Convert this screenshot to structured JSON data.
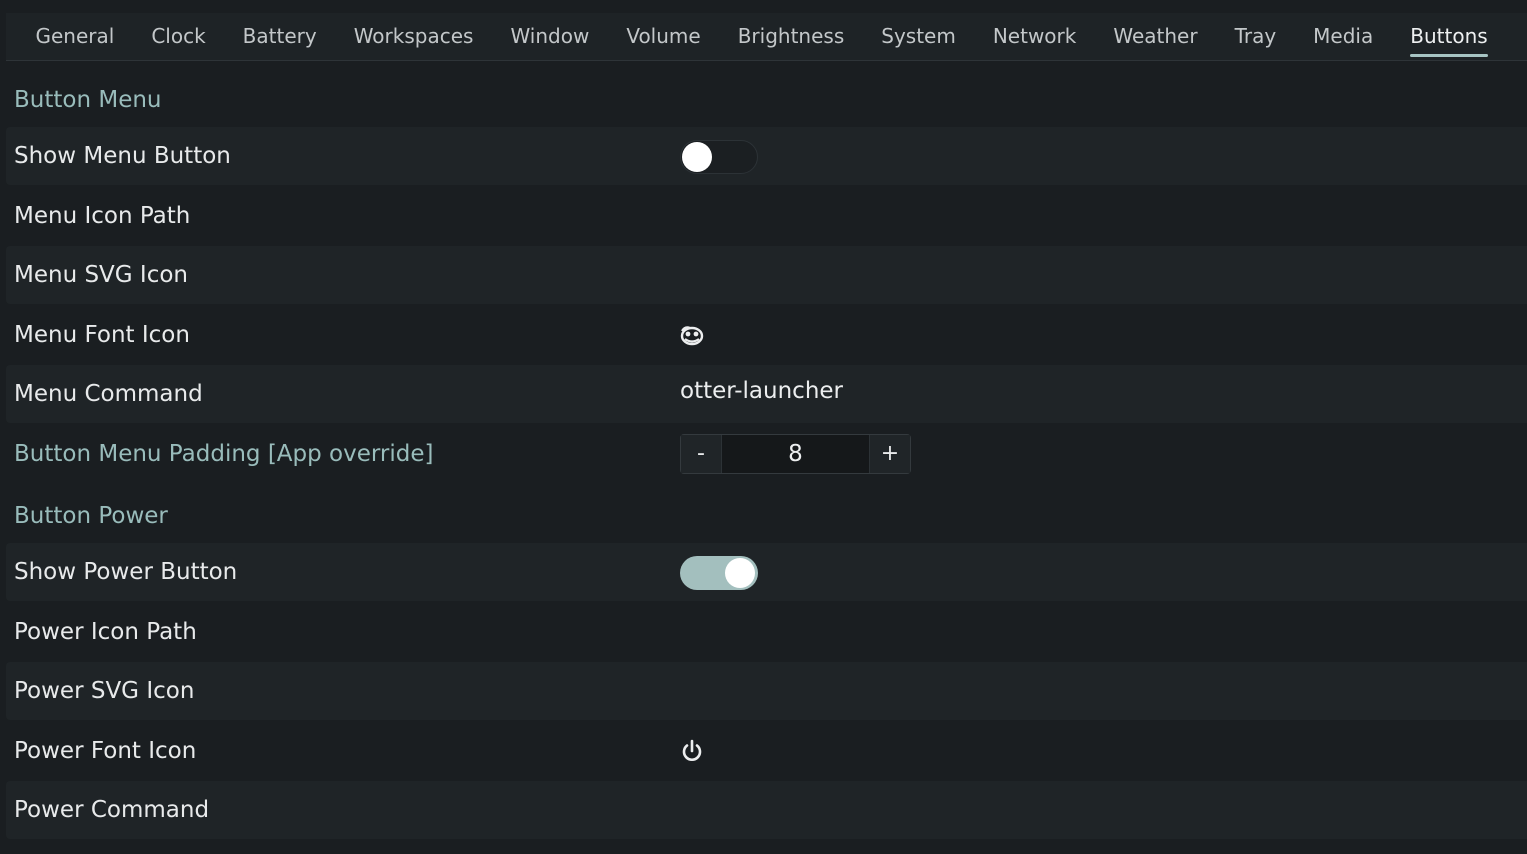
{
  "tabs": [
    {
      "label": "General"
    },
    {
      "label": "Clock"
    },
    {
      "label": "Battery"
    },
    {
      "label": "Workspaces"
    },
    {
      "label": "Window"
    },
    {
      "label": "Volume"
    },
    {
      "label": "Brightness"
    },
    {
      "label": "System"
    },
    {
      "label": "Network"
    },
    {
      "label": "Weather"
    },
    {
      "label": "Tray"
    },
    {
      "label": "Media"
    },
    {
      "label": "Buttons"
    }
  ],
  "active_tab": "Buttons",
  "button_menu": {
    "header": "Button Menu",
    "show_label": "Show Menu Button",
    "show_value": false,
    "icon_path_label": "Menu Icon Path",
    "icon_path_value": "",
    "svg_icon_label": "Menu SVG Icon",
    "svg_icon_value": "",
    "font_icon_label": "Menu Font Icon",
    "font_icon_name": "otter-icon",
    "command_label": "Menu Command",
    "command_value": "otter-launcher",
    "padding_label": "Button Menu Padding [App override]",
    "padding_minus": "-",
    "padding_value": "8",
    "padding_plus": "+"
  },
  "button_power": {
    "header": "Button Power",
    "show_label": "Show Power Button",
    "show_value": true,
    "icon_path_label": "Power Icon Path",
    "icon_path_value": "",
    "svg_icon_label": "Power SVG Icon",
    "svg_icon_value": "",
    "font_icon_label": "Power Font Icon",
    "font_icon_name": "power-icon",
    "command_label": "Power Command",
    "command_value": ""
  },
  "colors": {
    "background": "#1a1e21",
    "accent": "#99bcbb",
    "toggle_on": "#a3bfbe"
  }
}
